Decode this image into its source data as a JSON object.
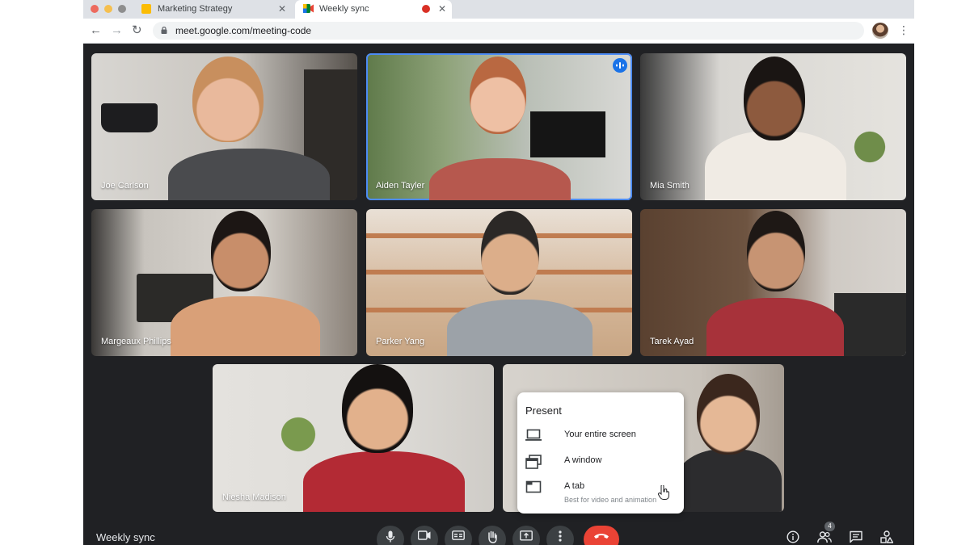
{
  "tabs": [
    {
      "title": "Marketing Strategy",
      "active": false,
      "favicon_color": "#fbbc04"
    },
    {
      "title": "Weekly sync",
      "active": true,
      "recording": true
    }
  ],
  "address_bar": {
    "url": "meet.google.com/meeting-code"
  },
  "participants": [
    {
      "name": "Joe Carlson"
    },
    {
      "name": "Aiden Tayler",
      "speaking": true
    },
    {
      "name": "Mia Smith"
    },
    {
      "name": "Margeaux Phillips"
    },
    {
      "name": "Parker Yang"
    },
    {
      "name": "Tarek Ayad"
    },
    {
      "name": "Niesha Madison"
    }
  ],
  "present_menu": {
    "title": "Present",
    "items": [
      {
        "label": "Your entire screen",
        "icon": "laptop-icon"
      },
      {
        "label": "A window",
        "icon": "window-icon"
      },
      {
        "label": "A tab",
        "icon": "tab-icon",
        "subtext": "Best for video and animation"
      }
    ]
  },
  "meeting": {
    "title": "Weekly sync",
    "people_count": "4"
  },
  "colors": {
    "accent": "#1a73e8",
    "end_call": "#ea4335",
    "speaking_outline": "#4c8bf5",
    "background": "#202124"
  }
}
